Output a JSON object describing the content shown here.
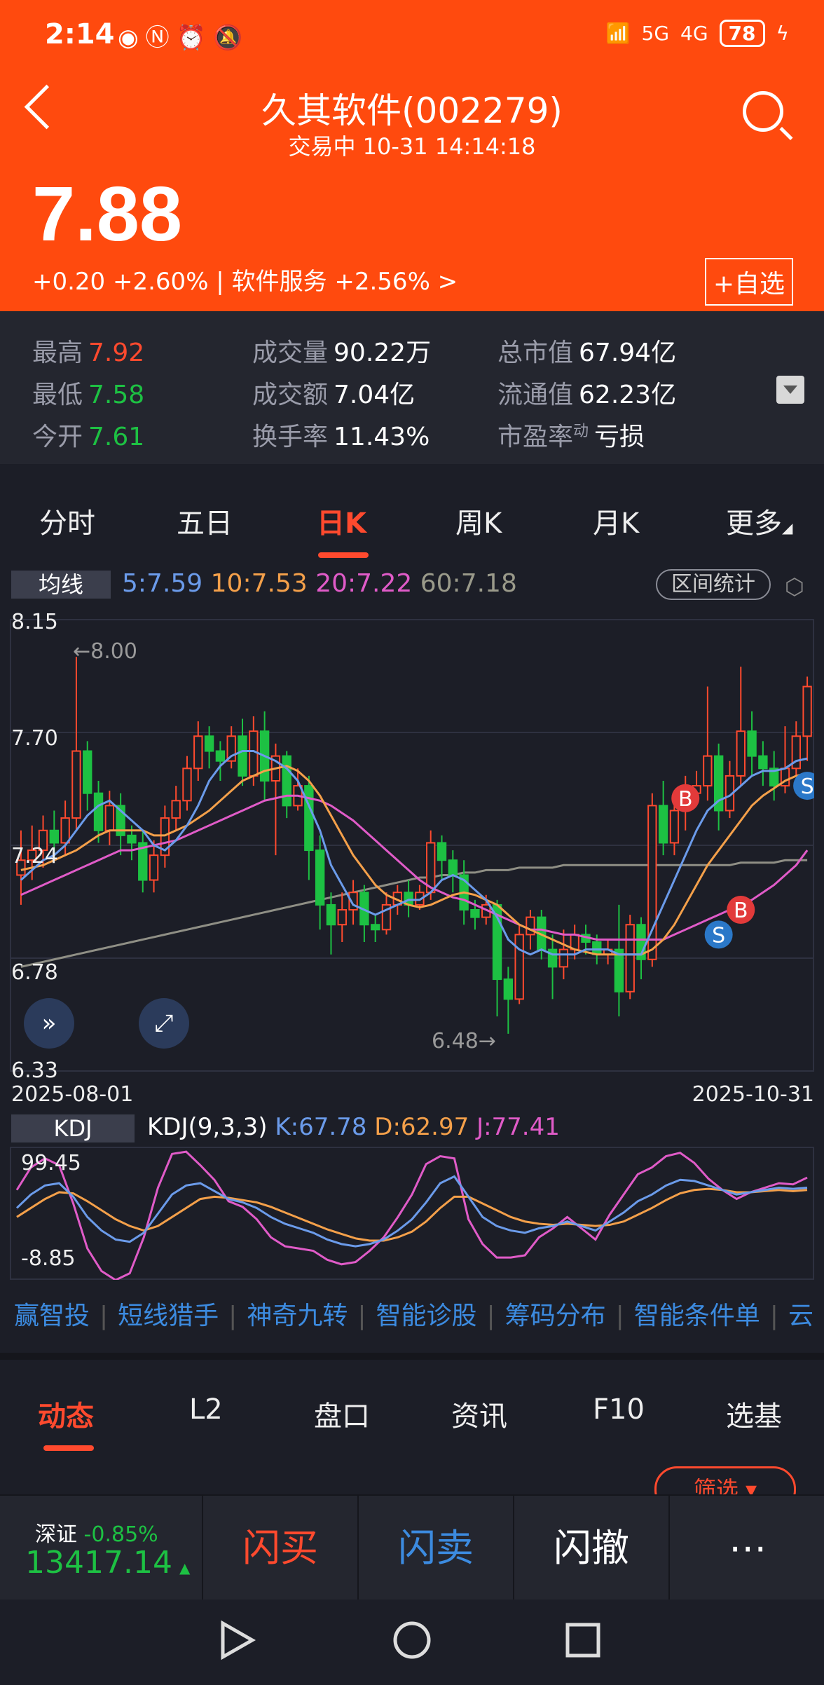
{
  "status": {
    "time": "2:14",
    "battery": "78",
    "net1": "5G",
    "net2": "4G"
  },
  "header": {
    "title": "久其软件(002279)",
    "subtitle": "交易中   10-31 14:14:18",
    "price": "7.88",
    "change": "+0.20  +2.60% | 软件服务  +2.56%  >",
    "add_fav": "+自选"
  },
  "stats": {
    "high_label": "最高",
    "high": "7.92",
    "low_label": "最低",
    "low": "7.58",
    "open_label": "今开",
    "open": "7.61",
    "vol_label": "成交量",
    "vol": "90.22万",
    "amt_label": "成交额",
    "amt": "7.04亿",
    "turn_label": "换手率",
    "turn": "11.43%",
    "mcap_label": "总市值",
    "mcap": "67.94亿",
    "float_label": "流通值",
    "float": "62.23亿",
    "pe_label": "市盈率",
    "pe_sup": "动",
    "pe": "亏损"
  },
  "tabs": [
    "分时",
    "五日",
    "日K",
    "周K",
    "月K",
    "更多"
  ],
  "ma": {
    "box": "均线",
    "ma5": "5:7.59",
    "ma10": "10:7.53",
    "ma20": "20:7.22",
    "ma60": "60:7.18",
    "range_btn": "区间统计"
  },
  "chart": {
    "y_labels": [
      "8.15",
      "7.70",
      "7.24",
      "6.78",
      "6.33"
    ],
    "x_start": "2025-08-01",
    "x_end": "2025-10-31",
    "hi_note": "←8.00",
    "lo_note": "6.48→",
    "fab1": "»",
    "fab2": "⤢",
    "marks": [
      "B",
      "B",
      "S",
      "S"
    ]
  },
  "kdj": {
    "box": "KDJ",
    "label": "KDJ(9,3,3)",
    "k": "K:67.78",
    "d": "D:62.97",
    "j": "J:77.41",
    "top": "99.45",
    "bottom": "-8.85"
  },
  "quick": [
    "赢智投",
    "短线猎手",
    "神奇九转",
    "智能诊股",
    "筹码分布",
    "智能条件单",
    "云"
  ],
  "btabs": [
    "动态",
    "L2",
    "盘口",
    "资讯",
    "F10",
    "选基"
  ],
  "filter": "筛选 ▾",
  "trade": {
    "index_name": "深证",
    "index_chg": "-0.85%",
    "index_val": "13417.14",
    "buy": "闪买",
    "sell": "闪卖",
    "cancel": "闪撤",
    "more": "⋯"
  },
  "chart_data": {
    "type": "candlestick",
    "ylim": [
      6.33,
      8.15
    ],
    "x_range": [
      "2025-08-01",
      "2025-10-31"
    ],
    "series": [
      {
        "open": 7.12,
        "close": 7.18,
        "high": 7.3,
        "low": 7.0
      },
      {
        "open": 7.18,
        "close": 7.22,
        "high": 7.32,
        "low": 7.1
      },
      {
        "open": 7.22,
        "close": 7.3,
        "high": 7.36,
        "low": 7.15
      },
      {
        "open": 7.3,
        "close": 7.25,
        "high": 7.38,
        "low": 7.18
      },
      {
        "open": 7.25,
        "close": 7.35,
        "high": 7.42,
        "low": 7.2
      },
      {
        "open": 7.35,
        "close": 7.62,
        "high": 8.0,
        "low": 7.3
      },
      {
        "open": 7.62,
        "close": 7.45,
        "high": 7.66,
        "low": 7.38
      },
      {
        "open": 7.45,
        "close": 7.3,
        "high": 7.5,
        "low": 7.25
      },
      {
        "open": 7.3,
        "close": 7.4,
        "high": 7.46,
        "low": 7.24
      },
      {
        "open": 7.4,
        "close": 7.28,
        "high": 7.45,
        "low": 7.2
      },
      {
        "open": 7.28,
        "close": 7.25,
        "high": 7.32,
        "low": 7.18
      },
      {
        "open": 7.25,
        "close": 7.1,
        "high": 7.3,
        "low": 7.05
      },
      {
        "open": 7.1,
        "close": 7.2,
        "high": 7.26,
        "low": 7.05
      },
      {
        "open": 7.2,
        "close": 7.35,
        "high": 7.4,
        "low": 7.15
      },
      {
        "open": 7.35,
        "close": 7.42,
        "high": 7.48,
        "low": 7.3
      },
      {
        "open": 7.42,
        "close": 7.55,
        "high": 7.6,
        "low": 7.38
      },
      {
        "open": 7.55,
        "close": 7.68,
        "high": 7.74,
        "low": 7.5
      },
      {
        "open": 7.68,
        "close": 7.62,
        "high": 7.72,
        "low": 7.55
      },
      {
        "open": 7.62,
        "close": 7.58,
        "high": 7.66,
        "low": 7.5
      },
      {
        "open": 7.58,
        "close": 7.68,
        "high": 7.72,
        "low": 7.55
      },
      {
        "open": 7.68,
        "close": 7.52,
        "high": 7.75,
        "low": 7.48
      },
      {
        "open": 7.52,
        "close": 7.7,
        "high": 7.76,
        "low": 7.48
      },
      {
        "open": 7.7,
        "close": 7.5,
        "high": 7.78,
        "low": 7.42
      },
      {
        "open": 7.5,
        "close": 7.6,
        "high": 7.65,
        "low": 7.2
      },
      {
        "open": 7.6,
        "close": 7.4,
        "high": 7.62,
        "low": 7.35
      },
      {
        "open": 7.4,
        "close": 7.48,
        "high": 7.55,
        "low": 7.38
      },
      {
        "open": 7.48,
        "close": 7.22,
        "high": 7.52,
        "low": 7.1
      },
      {
        "open": 7.22,
        "close": 7.0,
        "high": 7.28,
        "low": 6.9
      },
      {
        "open": 7.0,
        "close": 6.92,
        "high": 7.05,
        "low": 6.8
      },
      {
        "open": 6.92,
        "close": 6.98,
        "high": 7.05,
        "low": 6.85
      },
      {
        "open": 6.98,
        "close": 7.05,
        "high": 7.1,
        "low": 6.92
      },
      {
        "open": 7.05,
        "close": 6.92,
        "high": 7.08,
        "low": 6.85
      },
      {
        "open": 6.92,
        "close": 6.9,
        "high": 6.96,
        "low": 6.85
      },
      {
        "open": 6.9,
        "close": 7.0,
        "high": 7.05,
        "low": 6.88
      },
      {
        "open": 7.0,
        "close": 7.05,
        "high": 7.08,
        "low": 6.96
      },
      {
        "open": 7.05,
        "close": 7.0,
        "high": 7.1,
        "low": 6.95
      },
      {
        "open": 7.0,
        "close": 7.05,
        "high": 7.08,
        "low": 6.98
      },
      {
        "open": 7.05,
        "close": 7.25,
        "high": 7.3,
        "low": 7.02
      },
      {
        "open": 7.25,
        "close": 7.18,
        "high": 7.28,
        "low": 7.1
      },
      {
        "open": 7.18,
        "close": 7.12,
        "high": 7.22,
        "low": 7.05
      },
      {
        "open": 7.12,
        "close": 6.98,
        "high": 7.18,
        "low": 6.92
      },
      {
        "open": 6.98,
        "close": 6.95,
        "high": 7.02,
        "low": 6.9
      },
      {
        "open": 6.95,
        "close": 7.0,
        "high": 7.04,
        "low": 6.92
      },
      {
        "open": 7.0,
        "close": 6.7,
        "high": 7.02,
        "low": 6.55
      },
      {
        "open": 6.7,
        "close": 6.62,
        "high": 6.75,
        "low": 6.48
      },
      {
        "open": 6.62,
        "close": 6.88,
        "high": 6.92,
        "low": 6.6
      },
      {
        "open": 6.88,
        "close": 6.95,
        "high": 6.98,
        "low": 6.82
      },
      {
        "open": 6.95,
        "close": 6.82,
        "high": 6.98,
        "low": 6.78
      },
      {
        "open": 6.82,
        "close": 6.75,
        "high": 6.88,
        "low": 6.62
      },
      {
        "open": 6.75,
        "close": 6.82,
        "high": 6.9,
        "low": 6.7
      },
      {
        "open": 6.82,
        "close": 6.88,
        "high": 6.92,
        "low": 6.78
      },
      {
        "open": 6.88,
        "close": 6.85,
        "high": 6.92,
        "low": 6.8
      },
      {
        "open": 6.85,
        "close": 6.8,
        "high": 6.88,
        "low": 6.76
      },
      {
        "open": 6.8,
        "close": 6.82,
        "high": 6.86,
        "low": 6.76
      },
      {
        "open": 6.82,
        "close": 6.65,
        "high": 7.0,
        "low": 6.55
      },
      {
        "open": 6.65,
        "close": 6.92,
        "high": 6.96,
        "low": 6.62
      },
      {
        "open": 6.92,
        "close": 6.78,
        "high": 6.95,
        "low": 6.7
      },
      {
        "open": 6.78,
        "close": 7.4,
        "high": 7.45,
        "low": 6.75
      },
      {
        "open": 7.4,
        "close": 7.25,
        "high": 7.5,
        "low": 7.2
      },
      {
        "open": 7.25,
        "close": 7.38,
        "high": 7.45,
        "low": 7.2
      },
      {
        "open": 7.38,
        "close": 7.45,
        "high": 7.52,
        "low": 7.3
      },
      {
        "open": 7.45,
        "close": 7.48,
        "high": 7.54,
        "low": 7.4
      },
      {
        "open": 7.48,
        "close": 7.6,
        "high": 7.88,
        "low": 7.42
      },
      {
        "open": 7.6,
        "close": 7.38,
        "high": 7.65,
        "low": 7.3
      },
      {
        "open": 7.38,
        "close": 7.52,
        "high": 7.58,
        "low": 7.35
      },
      {
        "open": 7.52,
        "close": 7.7,
        "high": 7.96,
        "low": 7.48
      },
      {
        "open": 7.7,
        "close": 7.6,
        "high": 7.78,
        "low": 7.52
      },
      {
        "open": 7.6,
        "close": 7.55,
        "high": 7.66,
        "low": 7.48
      },
      {
        "open": 7.55,
        "close": 7.48,
        "high": 7.62,
        "low": 7.42
      },
      {
        "open": 7.48,
        "close": 7.55,
        "high": 7.72,
        "low": 7.45
      },
      {
        "open": 7.55,
        "close": 7.68,
        "high": 7.74,
        "low": 7.52
      },
      {
        "open": 7.68,
        "close": 7.88,
        "high": 7.92,
        "low": 7.58
      }
    ],
    "ma5": [
      7.1,
      7.14,
      7.18,
      7.2,
      7.24,
      7.3,
      7.36,
      7.4,
      7.42,
      7.38,
      7.34,
      7.3,
      7.24,
      7.22,
      7.26,
      7.32,
      7.4,
      7.5,
      7.56,
      7.6,
      7.62,
      7.62,
      7.6,
      7.58,
      7.55,
      7.5,
      7.4,
      7.3,
      7.16,
      7.08,
      7.0,
      6.98,
      6.96,
      6.98,
      7.0,
      7.02,
      7.02,
      7.05,
      7.1,
      7.12,
      7.1,
      7.06,
      7.02,
      6.95,
      6.86,
      6.82,
      6.8,
      6.82,
      6.8,
      6.8,
      6.8,
      6.82,
      6.82,
      6.82,
      6.8,
      6.8,
      6.8,
      6.9,
      7.0,
      7.1,
      7.2,
      7.3,
      7.38,
      7.42,
      7.44,
      7.48,
      7.52,
      7.54,
      7.54,
      7.55,
      7.58,
      7.59
    ],
    "ma10": [
      7.14,
      7.15,
      7.16,
      7.18,
      7.2,
      7.22,
      7.25,
      7.28,
      7.3,
      7.3,
      7.3,
      7.3,
      7.28,
      7.28,
      7.3,
      7.32,
      7.35,
      7.38,
      7.42,
      7.46,
      7.5,
      7.52,
      7.54,
      7.55,
      7.56,
      7.54,
      7.5,
      7.44,
      7.36,
      7.28,
      7.2,
      7.14,
      7.08,
      7.04,
      7.02,
      7.0,
      6.99,
      7.0,
      7.02,
      7.04,
      7.05,
      7.04,
      7.02,
      7.0,
      6.96,
      6.92,
      6.9,
      6.88,
      6.86,
      6.84,
      6.82,
      6.81,
      6.8,
      6.8,
      6.8,
      6.8,
      6.8,
      6.82,
      6.86,
      6.92,
      7.0,
      7.08,
      7.16,
      7.22,
      7.28,
      7.34,
      7.4,
      7.44,
      7.47,
      7.5,
      7.52,
      7.53
    ],
    "ma20": [
      7.04,
      7.06,
      7.08,
      7.1,
      7.12,
      7.14,
      7.16,
      7.18,
      7.2,
      7.22,
      7.22,
      7.23,
      7.24,
      7.25,
      7.26,
      7.28,
      7.3,
      7.32,
      7.34,
      7.36,
      7.38,
      7.4,
      7.42,
      7.43,
      7.44,
      7.44,
      7.43,
      7.42,
      7.4,
      7.37,
      7.34,
      7.3,
      7.26,
      7.22,
      7.18,
      7.14,
      7.1,
      7.07,
      7.05,
      7.03,
      7.02,
      7.0,
      6.98,
      6.96,
      6.94,
      6.92,
      6.9,
      6.9,
      6.89,
      6.88,
      6.88,
      6.87,
      6.86,
      6.86,
      6.86,
      6.86,
      6.86,
      6.86,
      6.86,
      6.88,
      6.9,
      6.92,
      6.94,
      6.96,
      6.98,
      7.0,
      7.02,
      7.05,
      7.08,
      7.12,
      7.16,
      7.22
    ],
    "ma60": [
      6.75,
      6.76,
      6.77,
      6.78,
      6.79,
      6.8,
      6.81,
      6.82,
      6.83,
      6.84,
      6.85,
      6.86,
      6.87,
      6.88,
      6.89,
      6.9,
      6.91,
      6.92,
      6.93,
      6.94,
      6.95,
      6.96,
      6.97,
      6.98,
      6.99,
      7.0,
      7.01,
      7.02,
      7.03,
      7.04,
      7.05,
      7.06,
      7.07,
      7.08,
      7.09,
      7.1,
      7.11,
      7.11,
      7.12,
      7.12,
      7.13,
      7.13,
      7.14,
      7.14,
      7.14,
      7.15,
      7.15,
      7.15,
      7.15,
      7.16,
      7.16,
      7.16,
      7.16,
      7.16,
      7.16,
      7.16,
      7.16,
      7.16,
      7.16,
      7.16,
      7.16,
      7.16,
      7.16,
      7.16,
      7.16,
      7.17,
      7.17,
      7.17,
      7.17,
      7.18,
      7.18,
      7.18
    ]
  },
  "kdj_data": {
    "ylim": [
      -8.85,
      99.45
    ],
    "k": [
      50,
      62,
      70,
      72,
      60,
      42,
      30,
      22,
      20,
      28,
      45,
      62,
      70,
      72,
      65,
      58,
      55,
      50,
      42,
      36,
      32,
      28,
      22,
      18,
      16,
      18,
      22,
      30,
      40,
      55,
      72,
      78,
      60,
      42,
      34,
      30,
      28,
      32,
      34,
      38,
      34,
      30,
      38,
      46,
      56,
      62,
      70,
      75,
      74,
      70,
      66,
      62,
      64,
      66,
      68,
      67,
      68
    ],
    "d": [
      42,
      50,
      58,
      64,
      63,
      56,
      48,
      40,
      34,
      30,
      34,
      42,
      50,
      58,
      60,
      59,
      57,
      55,
      51,
      46,
      41,
      36,
      31,
      27,
      23,
      21,
      21,
      24,
      29,
      38,
      50,
      60,
      60,
      54,
      48,
      42,
      38,
      36,
      35,
      36,
      35,
      34,
      35,
      38,
      44,
      50,
      57,
      63,
      66,
      67,
      66,
      64,
      64,
      65,
      66,
      65,
      66
    ],
    "j": [
      66,
      86,
      94,
      88,
      54,
      14,
      -6,
      -14,
      -8,
      24,
      68,
      98,
      100,
      88,
      75,
      56,
      51,
      40,
      24,
      16,
      14,
      12,
      4,
      0,
      2,
      12,
      24,
      42,
      62,
      89,
      96,
      94,
      40,
      18,
      6,
      6,
      8,
      24,
      32,
      42,
      32,
      22,
      44,
      62,
      80,
      86,
      96,
      99,
      90,
      76,
      66,
      58,
      64,
      68,
      72,
      71,
      77
    ]
  }
}
